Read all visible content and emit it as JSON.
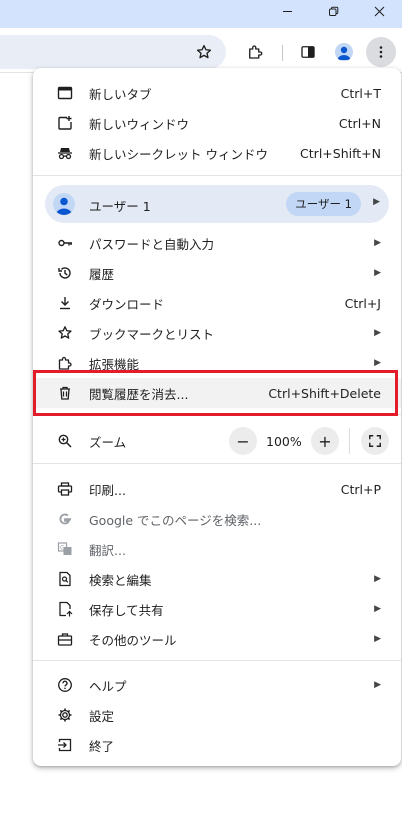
{
  "colors": {
    "titlebar_bg": "#d3e3fd",
    "highlight_border": "#e31c2a",
    "profile_bg": "#e3eaf6",
    "accent_blue": "#0b57d0"
  },
  "window_controls": {
    "minimize_icon": "minimize-icon",
    "restore_icon": "restore-icon",
    "close_icon": "close-icon"
  },
  "toolbar": {
    "bookmark_icon": "star-icon",
    "extensions_icon": "puzzle-icon",
    "side_panel_icon": "side-panel-icon",
    "profile_icon": "avatar-icon",
    "menu_icon": "kebab-menu-icon"
  },
  "menu": {
    "new_tab": {
      "label": "新しいタブ",
      "shortcut": "Ctrl+T"
    },
    "new_window": {
      "label": "新しいウィンドウ",
      "shortcut": "Ctrl+N"
    },
    "incognito": {
      "label": "新しいシークレット ウィンドウ",
      "shortcut": "Ctrl+Shift+N"
    },
    "profile": {
      "name": "ユーザー 1",
      "chip": "ユーザー 1"
    },
    "passwords": {
      "label": "パスワードと自動入力"
    },
    "history": {
      "label": "履歴"
    },
    "downloads": {
      "label": "ダウンロード",
      "shortcut": "Ctrl+J"
    },
    "bookmarks": {
      "label": "ブックマークとリスト"
    },
    "extensions": {
      "label": "拡張機能"
    },
    "clear_data": {
      "label": "閲覧履歴を消去...",
      "shortcut": "Ctrl+Shift+Delete"
    },
    "zoom": {
      "label": "ズーム",
      "minus": "−",
      "value": "100%",
      "plus": "+"
    },
    "print": {
      "label": "印刷...",
      "shortcut": "Ctrl+P"
    },
    "google_search": {
      "label": "Google でこのページを検索..."
    },
    "translate": {
      "label": "翻訳..."
    },
    "find_edit": {
      "label": "検索と編集"
    },
    "save_share": {
      "label": "保存して共有"
    },
    "more_tools": {
      "label": "その他のツール"
    },
    "help": {
      "label": "ヘルプ"
    },
    "settings": {
      "label": "設定"
    },
    "exit": {
      "label": "終了"
    }
  }
}
